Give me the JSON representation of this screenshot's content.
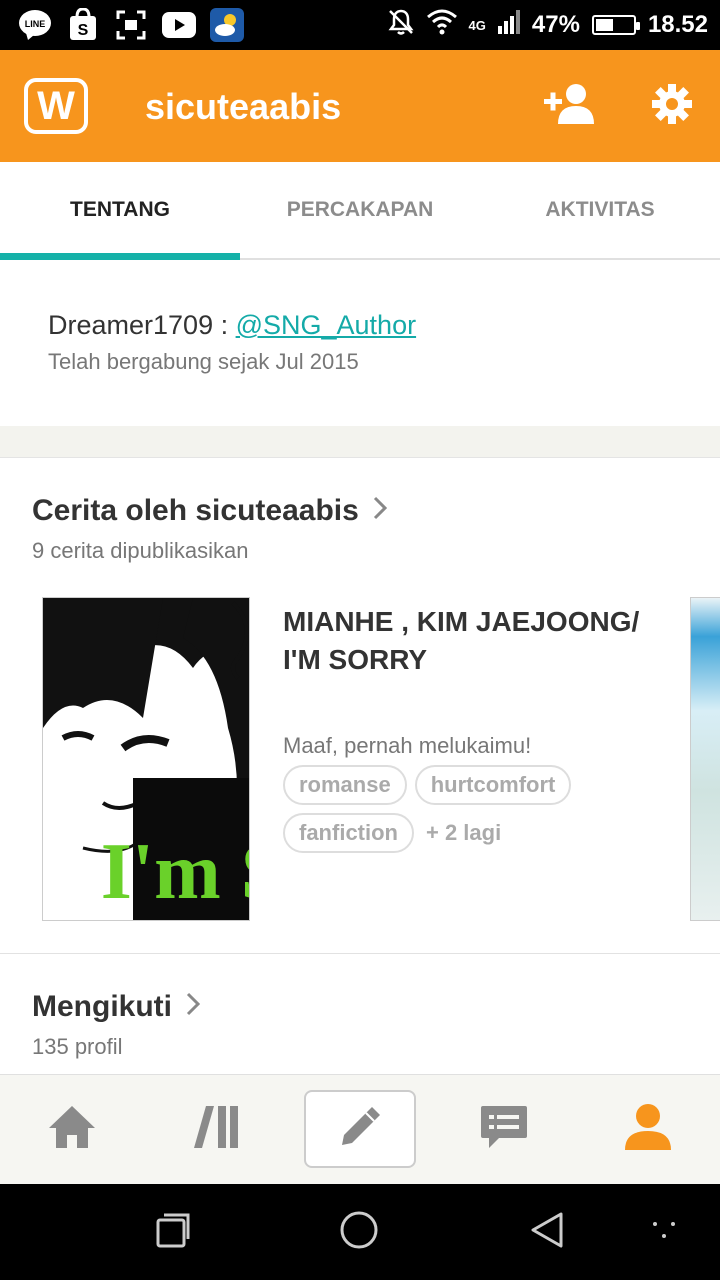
{
  "status_bar": {
    "apps": [
      "line-icon",
      "shopee-icon",
      "screenshot-icon",
      "youtube-icon",
      "weather-icon"
    ],
    "line_label": "LINE",
    "network": "4G",
    "battery": "47%",
    "battery_level": 0.47,
    "time": "18.52"
  },
  "app_bar": {
    "logo_letter": "W",
    "title": "sicuteaabis",
    "accent_color": "#f7951d"
  },
  "tabs": [
    {
      "label": "TENTANG",
      "active": true
    },
    {
      "label": "PERCAKAPAN",
      "active": false
    },
    {
      "label": "AKTIVITAS",
      "active": false
    }
  ],
  "about": {
    "text_prefix": "Dreamer1709 : ",
    "link": "@SNG_Author",
    "joined": "Telah bergabung sejak Jul 2015"
  },
  "stories": {
    "title": "Cerita oleh sicuteaabis",
    "subtitle": "9 cerita dipublikasikan",
    "items": [
      {
        "title": "MIANHE , KIM JAEJOONG/ I'M  SORRY",
        "description": "Maaf, pernah melukaimu!",
        "tags": [
          "romanse",
          "hurtcomfort",
          "fanfiction"
        ],
        "more": "+ 2 lagi",
        "cover_text": "I'm S"
      }
    ]
  },
  "following": {
    "title": "Mengikuti",
    "subtitle": "135 profil"
  },
  "bottom_nav": [
    "home-icon",
    "library-icon",
    "write-icon",
    "messages-icon",
    "profile-icon"
  ],
  "colors": {
    "teal": "#14b1a8",
    "orange": "#f7951d",
    "nav_gray": "#8a8a8a"
  }
}
